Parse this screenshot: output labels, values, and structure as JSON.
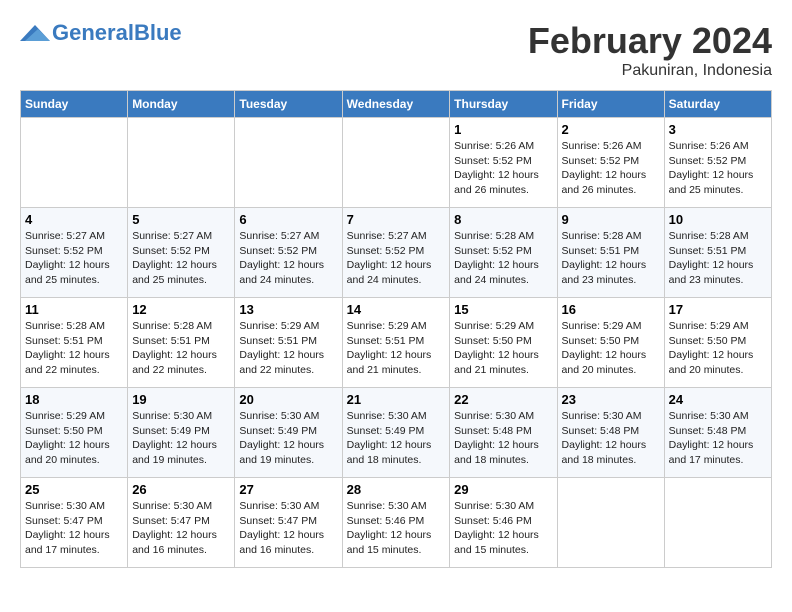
{
  "header": {
    "logo_general": "General",
    "logo_blue": "Blue",
    "title": "February 2024",
    "subtitle": "Pakuniran, Indonesia"
  },
  "columns": [
    "Sunday",
    "Monday",
    "Tuesday",
    "Wednesday",
    "Thursday",
    "Friday",
    "Saturday"
  ],
  "weeks": [
    [
      {
        "day": "",
        "detail": ""
      },
      {
        "day": "",
        "detail": ""
      },
      {
        "day": "",
        "detail": ""
      },
      {
        "day": "",
        "detail": ""
      },
      {
        "day": "1",
        "detail": "Sunrise: 5:26 AM\nSunset: 5:52 PM\nDaylight: 12 hours\nand 26 minutes."
      },
      {
        "day": "2",
        "detail": "Sunrise: 5:26 AM\nSunset: 5:52 PM\nDaylight: 12 hours\nand 26 minutes."
      },
      {
        "day": "3",
        "detail": "Sunrise: 5:26 AM\nSunset: 5:52 PM\nDaylight: 12 hours\nand 25 minutes."
      }
    ],
    [
      {
        "day": "4",
        "detail": "Sunrise: 5:27 AM\nSunset: 5:52 PM\nDaylight: 12 hours\nand 25 minutes."
      },
      {
        "day": "5",
        "detail": "Sunrise: 5:27 AM\nSunset: 5:52 PM\nDaylight: 12 hours\nand 25 minutes."
      },
      {
        "day": "6",
        "detail": "Sunrise: 5:27 AM\nSunset: 5:52 PM\nDaylight: 12 hours\nand 24 minutes."
      },
      {
        "day": "7",
        "detail": "Sunrise: 5:27 AM\nSunset: 5:52 PM\nDaylight: 12 hours\nand 24 minutes."
      },
      {
        "day": "8",
        "detail": "Sunrise: 5:28 AM\nSunset: 5:52 PM\nDaylight: 12 hours\nand 24 minutes."
      },
      {
        "day": "9",
        "detail": "Sunrise: 5:28 AM\nSunset: 5:51 PM\nDaylight: 12 hours\nand 23 minutes."
      },
      {
        "day": "10",
        "detail": "Sunrise: 5:28 AM\nSunset: 5:51 PM\nDaylight: 12 hours\nand 23 minutes."
      }
    ],
    [
      {
        "day": "11",
        "detail": "Sunrise: 5:28 AM\nSunset: 5:51 PM\nDaylight: 12 hours\nand 22 minutes."
      },
      {
        "day": "12",
        "detail": "Sunrise: 5:28 AM\nSunset: 5:51 PM\nDaylight: 12 hours\nand 22 minutes."
      },
      {
        "day": "13",
        "detail": "Sunrise: 5:29 AM\nSunset: 5:51 PM\nDaylight: 12 hours\nand 22 minutes."
      },
      {
        "day": "14",
        "detail": "Sunrise: 5:29 AM\nSunset: 5:51 PM\nDaylight: 12 hours\nand 21 minutes."
      },
      {
        "day": "15",
        "detail": "Sunrise: 5:29 AM\nSunset: 5:50 PM\nDaylight: 12 hours\nand 21 minutes."
      },
      {
        "day": "16",
        "detail": "Sunrise: 5:29 AM\nSunset: 5:50 PM\nDaylight: 12 hours\nand 20 minutes."
      },
      {
        "day": "17",
        "detail": "Sunrise: 5:29 AM\nSunset: 5:50 PM\nDaylight: 12 hours\nand 20 minutes."
      }
    ],
    [
      {
        "day": "18",
        "detail": "Sunrise: 5:29 AM\nSunset: 5:50 PM\nDaylight: 12 hours\nand 20 minutes."
      },
      {
        "day": "19",
        "detail": "Sunrise: 5:30 AM\nSunset: 5:49 PM\nDaylight: 12 hours\nand 19 minutes."
      },
      {
        "day": "20",
        "detail": "Sunrise: 5:30 AM\nSunset: 5:49 PM\nDaylight: 12 hours\nand 19 minutes."
      },
      {
        "day": "21",
        "detail": "Sunrise: 5:30 AM\nSunset: 5:49 PM\nDaylight: 12 hours\nand 18 minutes."
      },
      {
        "day": "22",
        "detail": "Sunrise: 5:30 AM\nSunset: 5:48 PM\nDaylight: 12 hours\nand 18 minutes."
      },
      {
        "day": "23",
        "detail": "Sunrise: 5:30 AM\nSunset: 5:48 PM\nDaylight: 12 hours\nand 18 minutes."
      },
      {
        "day": "24",
        "detail": "Sunrise: 5:30 AM\nSunset: 5:48 PM\nDaylight: 12 hours\nand 17 minutes."
      }
    ],
    [
      {
        "day": "25",
        "detail": "Sunrise: 5:30 AM\nSunset: 5:47 PM\nDaylight: 12 hours\nand 17 minutes."
      },
      {
        "day": "26",
        "detail": "Sunrise: 5:30 AM\nSunset: 5:47 PM\nDaylight: 12 hours\nand 16 minutes."
      },
      {
        "day": "27",
        "detail": "Sunrise: 5:30 AM\nSunset: 5:47 PM\nDaylight: 12 hours\nand 16 minutes."
      },
      {
        "day": "28",
        "detail": "Sunrise: 5:30 AM\nSunset: 5:46 PM\nDaylight: 12 hours\nand 15 minutes."
      },
      {
        "day": "29",
        "detail": "Sunrise: 5:30 AM\nSunset: 5:46 PM\nDaylight: 12 hours\nand 15 minutes."
      },
      {
        "day": "",
        "detail": ""
      },
      {
        "day": "",
        "detail": ""
      }
    ]
  ]
}
